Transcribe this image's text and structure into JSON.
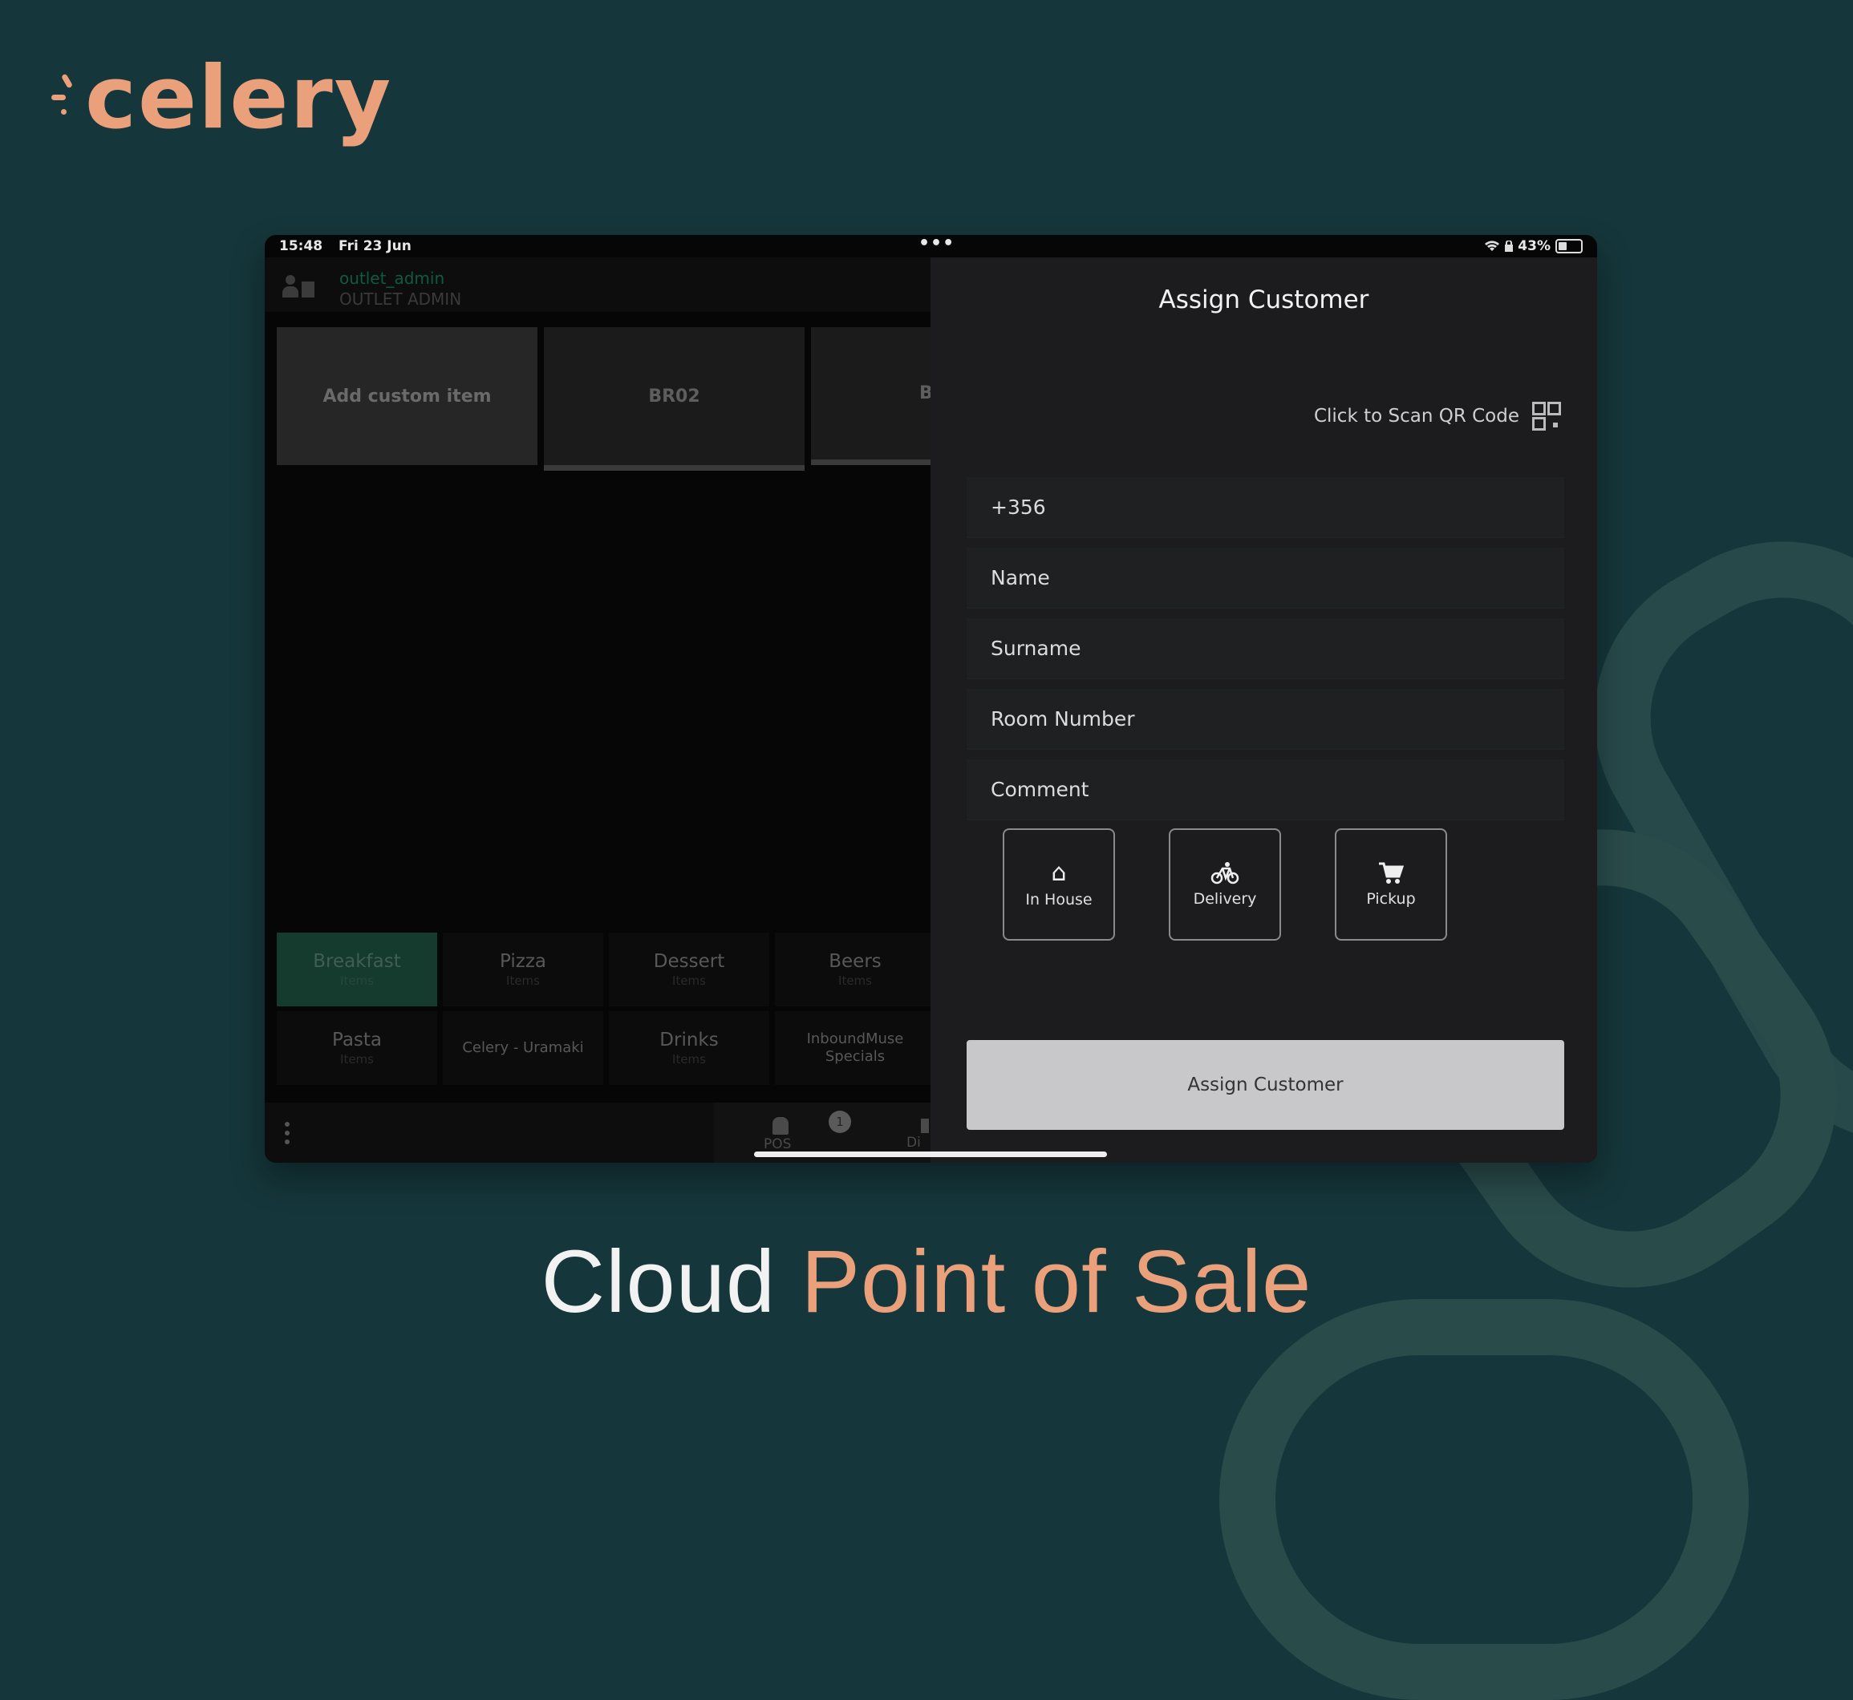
{
  "brand": {
    "name": "celery",
    "color": "#e9a07b"
  },
  "status_bar": {
    "time": "15:48",
    "date": "Fri 23 Jun",
    "dots": "•••",
    "battery": "43%",
    "wifi_icon": "wifi-icon",
    "lock_icon": "lock-icon"
  },
  "pos": {
    "user": {
      "name": "outlet_admin",
      "role": "OUTLET ADMIN"
    },
    "tiles": [
      "Add custom item",
      "BR02",
      "B"
    ],
    "categories": [
      {
        "name": "Breakfast",
        "sub": "Items",
        "active": true
      },
      {
        "name": "Pizza",
        "sub": "Items"
      },
      {
        "name": "Dessert",
        "sub": "Items"
      },
      {
        "name": "Beers",
        "sub": "Items"
      },
      {
        "name": "Pasta",
        "sub": "Items"
      },
      {
        "name": "Celery - Uramaki",
        "sub": ""
      },
      {
        "name": "Drinks",
        "sub": "Items"
      },
      {
        "name": "InboundMuse Specials",
        "sub": ""
      }
    ],
    "bottom": {
      "pos_label": "POS",
      "badge": "1",
      "dine_label": "Di"
    }
  },
  "assign_panel": {
    "title": "Assign Customer",
    "scan_label": "Click to Scan QR Code",
    "fields": {
      "phone": "+356",
      "name": "Name",
      "surname": "Surname",
      "room": "Room Number",
      "comment": "Comment"
    },
    "order_types": [
      "In House",
      "Delivery",
      "Pickup"
    ],
    "submit_label": "Assign Customer"
  },
  "tagline": {
    "part1": "Cloud ",
    "part2": "Point of Sale"
  }
}
